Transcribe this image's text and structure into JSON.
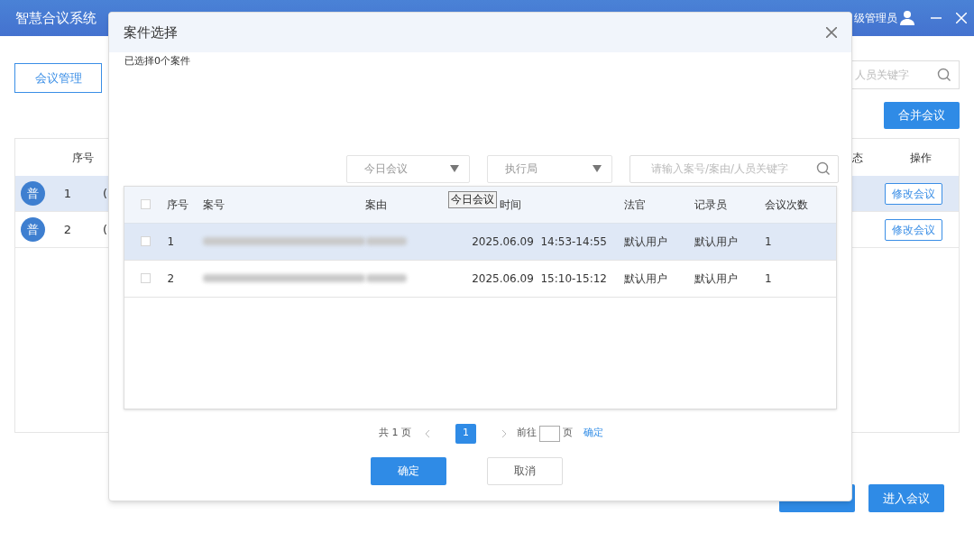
{
  "app": {
    "title": "智慧合议系统",
    "user": "级管理员"
  },
  "tabs": [
    {
      "label": "会议管理",
      "selected": true
    }
  ],
  "search": {
    "placeholder": "人员关键字"
  },
  "merge_button": "合并会议",
  "table": {
    "columns": [
      "序号",
      "态",
      "操作"
    ],
    "rows": [
      {
        "badge": "普",
        "index": "1",
        "column_3": "(",
        "action": "修改会议",
        "selected": true
      },
      {
        "badge": "普",
        "index": "2",
        "column_3": "(",
        "action": "修改会议",
        "selected": false
      }
    ]
  },
  "footer_button": "进入会议",
  "dialog": {
    "title": "案件选择",
    "selected_count": "已选择0个案件",
    "filters": [
      {
        "kind": "select",
        "value": "今日会议"
      },
      {
        "kind": "select",
        "value": "执行局"
      },
      {
        "kind": "search",
        "placeholder": "请输入案号/案由/人员关键字"
      }
    ],
    "tooltip": "今日会议",
    "table": {
      "all_checked": false,
      "columns": [
        "序号",
        "案号",
        "案由",
        "时间",
        "法官",
        "记录员",
        "会议次数"
      ],
      "rows": [
        {
          "checked": false,
          "selected": true,
          "index": "1",
          "time": "2025.06.09  14:53-14:55",
          "judge": "默认用户",
          "clerk": "默认用户",
          "count": "1"
        },
        {
          "checked": false,
          "selected": false,
          "index": "2",
          "time": "2025.06.09  15:10-15:12",
          "judge": "默认用户",
          "clerk": "默认用户",
          "count": "1"
        }
      ]
    },
    "pagination": {
      "total": "共 1 页",
      "pages": [
        {
          "label": "1",
          "selected": true
        }
      ],
      "goto": "前往",
      "goto_unit": "页",
      "confirm": "确定"
    },
    "buttons": {
      "confirm": "确定",
      "cancel": "取消"
    }
  }
}
